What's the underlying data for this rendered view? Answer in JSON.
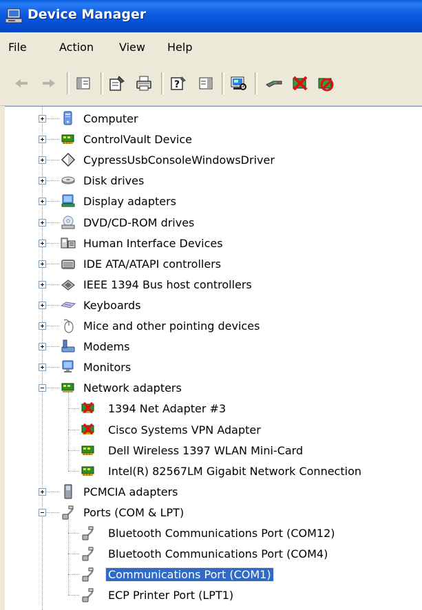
{
  "window": {
    "title": "Device Manager"
  },
  "menu": [
    "File",
    "Action",
    "View",
    "Help"
  ],
  "toolbar": [
    "back-icon",
    "forward-icon",
    "show-hide-tree-icon",
    "properties-icon",
    "print-icon",
    "help-icon",
    "show-hide-action-pane-icon",
    "scan-hardware-icon",
    "update-driver-icon",
    "uninstall-icon",
    "disable-icon"
  ],
  "tree": {
    "categories_top": [
      {
        "label": "Computer",
        "icon": "computer-icon"
      },
      {
        "label": "ControlVault Device",
        "icon": "board-icon"
      },
      {
        "label": "CypressUsbConsoleWindowsDriver",
        "icon": "diamond-icon"
      },
      {
        "label": "Disk drives",
        "icon": "disk-icon"
      },
      {
        "label": "Display adapters",
        "icon": "display-icon"
      },
      {
        "label": "DVD/CD-ROM drives",
        "icon": "dvd-icon"
      },
      {
        "label": "Human Interface Devices",
        "icon": "hid-icon"
      },
      {
        "label": "IDE ATA/ATAPI controllers",
        "icon": "ide-icon"
      },
      {
        "label": "IEEE 1394 Bus host controllers",
        "icon": "firewire-icon"
      },
      {
        "label": "Keyboards",
        "icon": "keyboard-icon"
      },
      {
        "label": "Mice and other pointing devices",
        "icon": "mouse-icon"
      },
      {
        "label": "Modems",
        "icon": "modem-icon"
      },
      {
        "label": "Monitors",
        "icon": "monitor-icon"
      }
    ],
    "network": {
      "label": "Network adapters",
      "children": [
        {
          "label": "1394 Net Adapter #3",
          "icon": "disabled-board-icon"
        },
        {
          "label": "Cisco Systems VPN Adapter",
          "icon": "disabled-board-icon"
        },
        {
          "label": "Dell Wireless 1397 WLAN Mini-Card",
          "icon": "board-icon"
        },
        {
          "label": "Intel(R) 82567LM Gigabit Network Connection",
          "icon": "board-icon"
        }
      ]
    },
    "pcmcia": {
      "label": "PCMCIA adapters"
    },
    "ports": {
      "label": "Ports (COM & LPT)",
      "children": [
        {
          "label": "Bluetooth Communications Port (COM12)",
          "icon": "port-icon"
        },
        {
          "label": "Bluetooth Communications Port (COM4)",
          "icon": "port-icon"
        },
        {
          "label": "Communications Port (COM1)",
          "icon": "port-icon",
          "selected": true
        },
        {
          "label": "ECP Printer Port (LPT1)",
          "icon": "port-icon"
        }
      ]
    }
  },
  "colors": {
    "titlebar": "#0a5fe0",
    "selection": "#316ac5",
    "chrome": "#ece9d8"
  }
}
